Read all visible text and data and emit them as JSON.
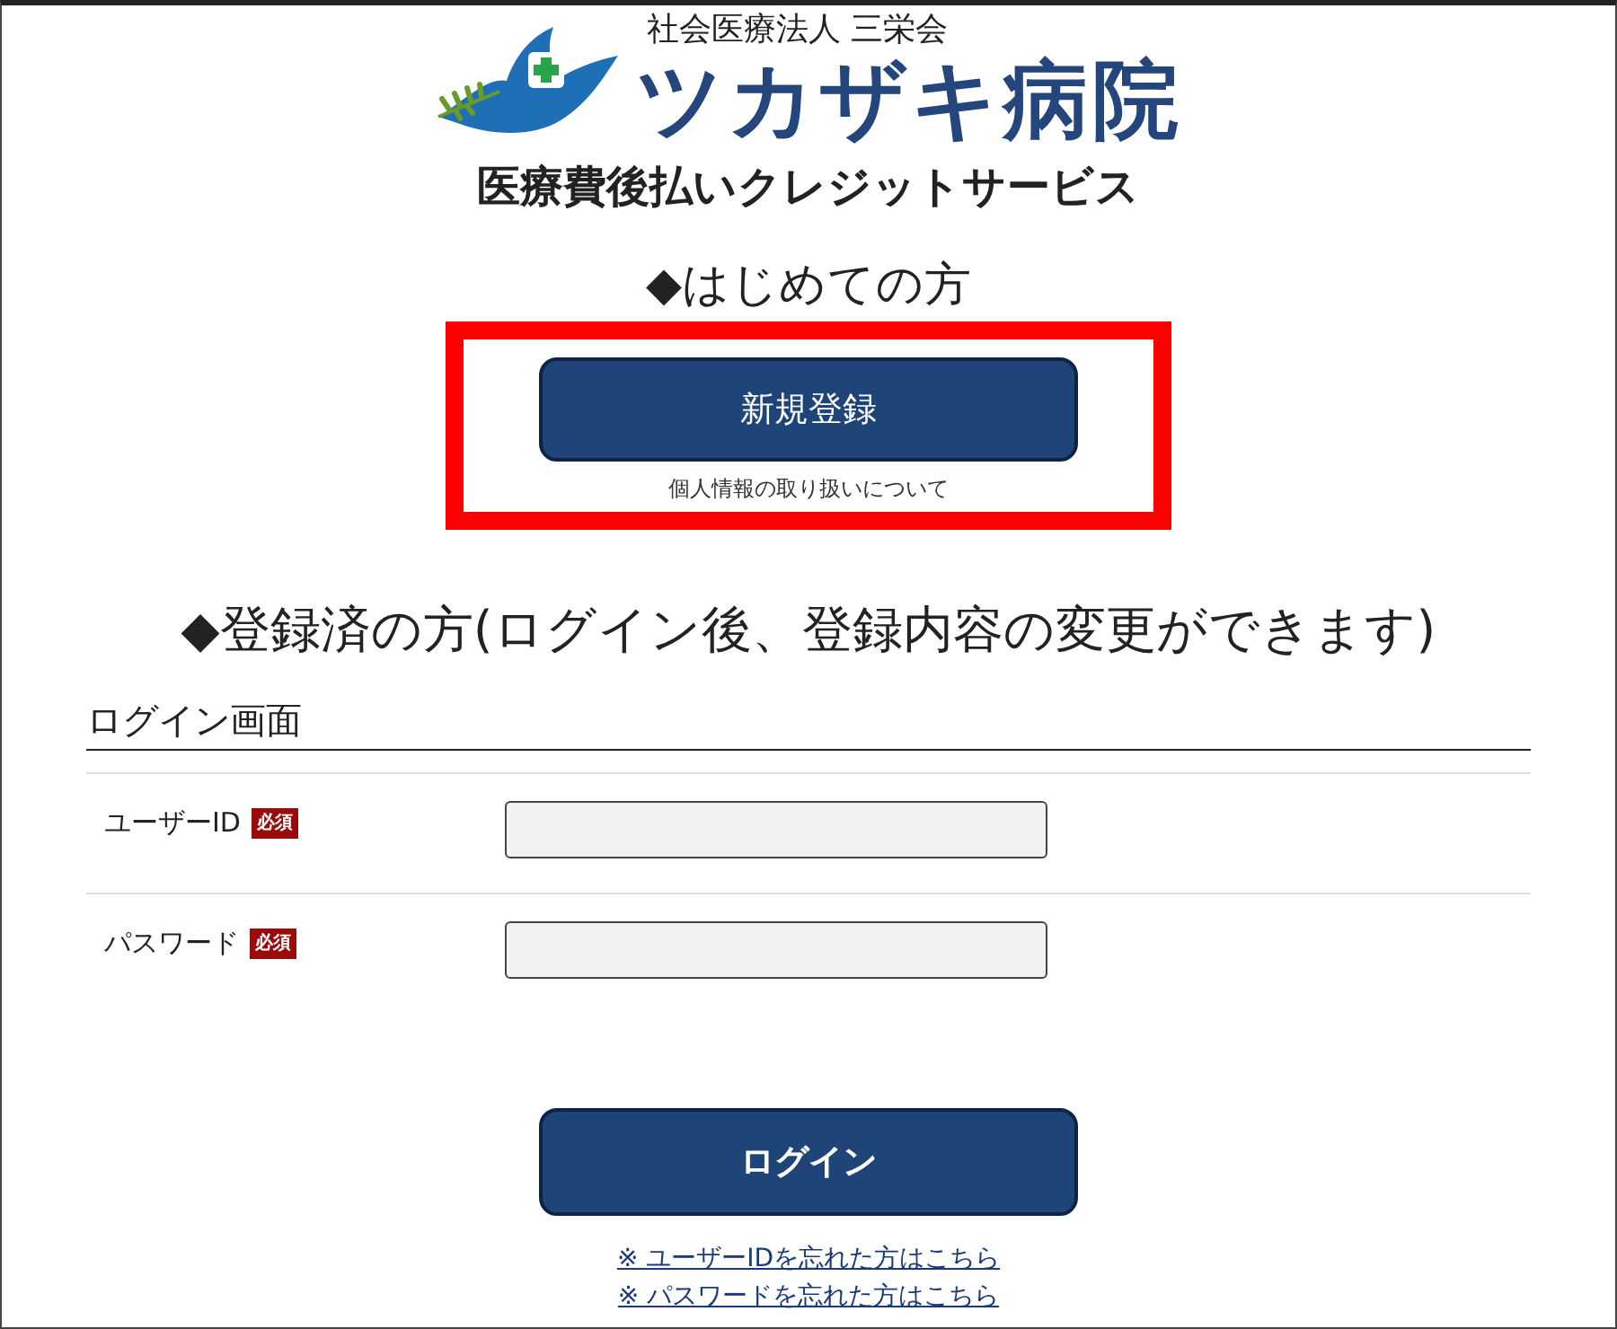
{
  "header": {
    "organization": "社会医療法人 三栄会",
    "hospital_name": "ツカザキ病院",
    "service_name": "医療費後払いクレジットサービス"
  },
  "new_user": {
    "heading": "◆はじめての方",
    "button": "新規登録",
    "privacy_link": "個人情報の取り扱いについて",
    "highlighted": true
  },
  "registered_user": {
    "heading": "◆登録済の方(ログイン後、登録内容の変更ができます)"
  },
  "login_form": {
    "title": "ログイン画面",
    "fields": [
      {
        "label": "ユーザーID",
        "badge": "必須"
      },
      {
        "label": "パスワード",
        "badge": "必須"
      }
    ],
    "button": "ログイン",
    "links": [
      "※ ユーザーIDを忘れた方はこちら",
      "※ パスワードを忘れた方はこちら"
    ]
  }
}
